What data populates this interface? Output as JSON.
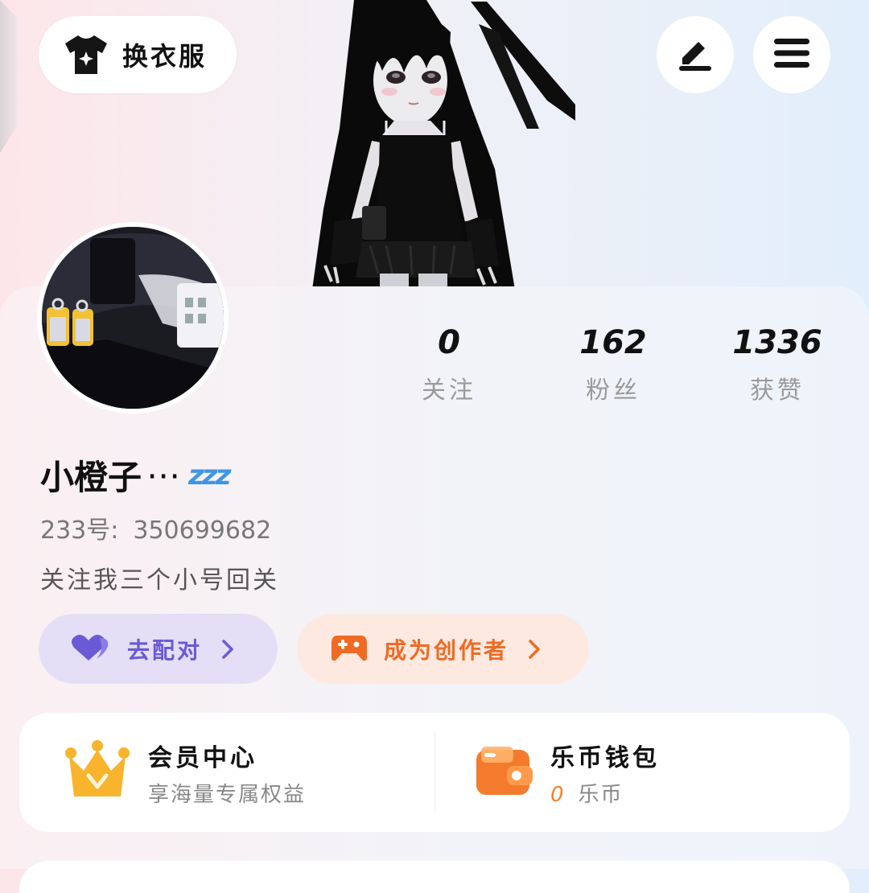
{
  "header": {
    "dress_up_label": "换衣服",
    "icons": {
      "dress_up": "tshirt-sparkle-icon",
      "edit": "pen-edit-icon",
      "menu": "hamburger-menu-icon"
    }
  },
  "stats": [
    {
      "value": "0",
      "label": "关注"
    },
    {
      "value": "162",
      "label": "粉丝"
    },
    {
      "value": "1336",
      "label": "获赞"
    }
  ],
  "profile": {
    "name": "小橙子",
    "name_suffix": "⋯",
    "name_emoji": "zzz",
    "id_label": "233号:",
    "id_value": "350699682",
    "bio": "关注我三个小号回关"
  },
  "actions": {
    "match_label": "去配对",
    "creator_label": "成为创作者"
  },
  "panel": {
    "vip_title": "会员中心",
    "vip_subtitle": "享海量专属权益",
    "wallet_title": "乐币钱包",
    "wallet_amount": "0",
    "wallet_unit": "乐币"
  },
  "colors": {
    "match_bg": "#e4dff7",
    "match_fg": "#6a5ad6",
    "creator_bg": "#fde9e0",
    "creator_fg": "#f06a24",
    "zzz": "#3f95e6",
    "vip_gold": "#f7b42c",
    "wallet_orange": "#f47a2e"
  }
}
